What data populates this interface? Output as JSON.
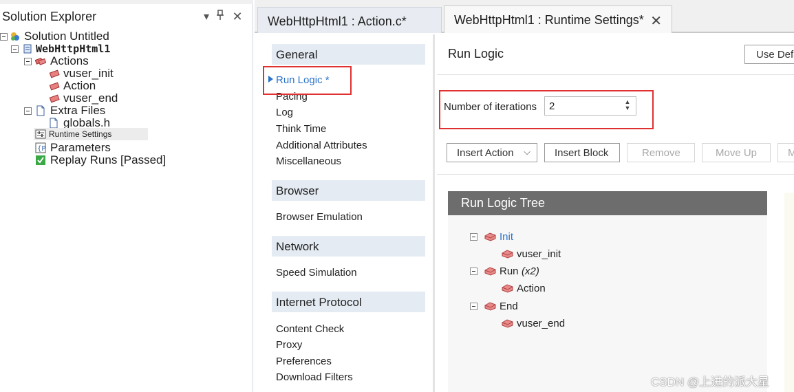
{
  "solution_explorer": {
    "title": "Solution Explorer",
    "tree": [
      {
        "label": "Solution Untitled",
        "icon": "solution-icon"
      },
      {
        "label": "WebHttpHtml1",
        "icon": "script-icon"
      },
      {
        "label": "Actions",
        "icon": "actions-icon"
      },
      {
        "label": "vuser_init",
        "icon": "action-brick-icon"
      },
      {
        "label": "Action",
        "icon": "action-brick-icon"
      },
      {
        "label": "vuser_end",
        "icon": "action-brick-icon"
      },
      {
        "label": "Extra Files",
        "icon": "file-icon"
      },
      {
        "label": "globals.h",
        "icon": "file-icon"
      },
      {
        "label": "Runtime Settings",
        "icon": "settings-icon"
      },
      {
        "label": "Parameters",
        "icon": "parameters-icon"
      },
      {
        "label": "Replay Runs [Passed]",
        "icon": "check-icon"
      }
    ]
  },
  "tabs": [
    {
      "label": "WebHttpHtml1 : Action.c*"
    },
    {
      "label": "WebHttpHtml1 : Runtime Settings*"
    }
  ],
  "nav": {
    "groups": [
      {
        "header": "General",
        "items": [
          "Run Logic *",
          "Pacing",
          "Log",
          "Think Time",
          "Additional Attributes",
          "Miscellaneous"
        ]
      },
      {
        "header": "Browser",
        "items": [
          "Browser Emulation"
        ]
      },
      {
        "header": "Network",
        "items": [
          "Speed Simulation"
        ]
      },
      {
        "header": "Internet Protocol",
        "items": [
          "Content Check",
          "Proxy",
          "Preferences",
          "Download Filters"
        ]
      }
    ]
  },
  "main": {
    "title": "Run Logic",
    "use_default": "Use Defaults",
    "iterations_label": "Number of iterations",
    "iterations_value": "2",
    "buttons": {
      "insert_action": "Insert Action",
      "insert_block": "Insert Block",
      "remove": "Remove",
      "move_up": "Move Up",
      "move_down": "M"
    },
    "tree_title": "Run Logic Tree",
    "tree": {
      "init": "Init",
      "init_child": "vuser_init",
      "run": "Run",
      "run_suffix": "(x2)",
      "run_child": "Action",
      "end": "End",
      "end_child": "vuser_end"
    }
  },
  "watermark": "CSDN @上进的派大星",
  "colors": {
    "accent": "#2a73c9",
    "highlight_box": "#e03030",
    "tree_header": "#6d6d6d",
    "nav_header": "#e4ebf3"
  }
}
